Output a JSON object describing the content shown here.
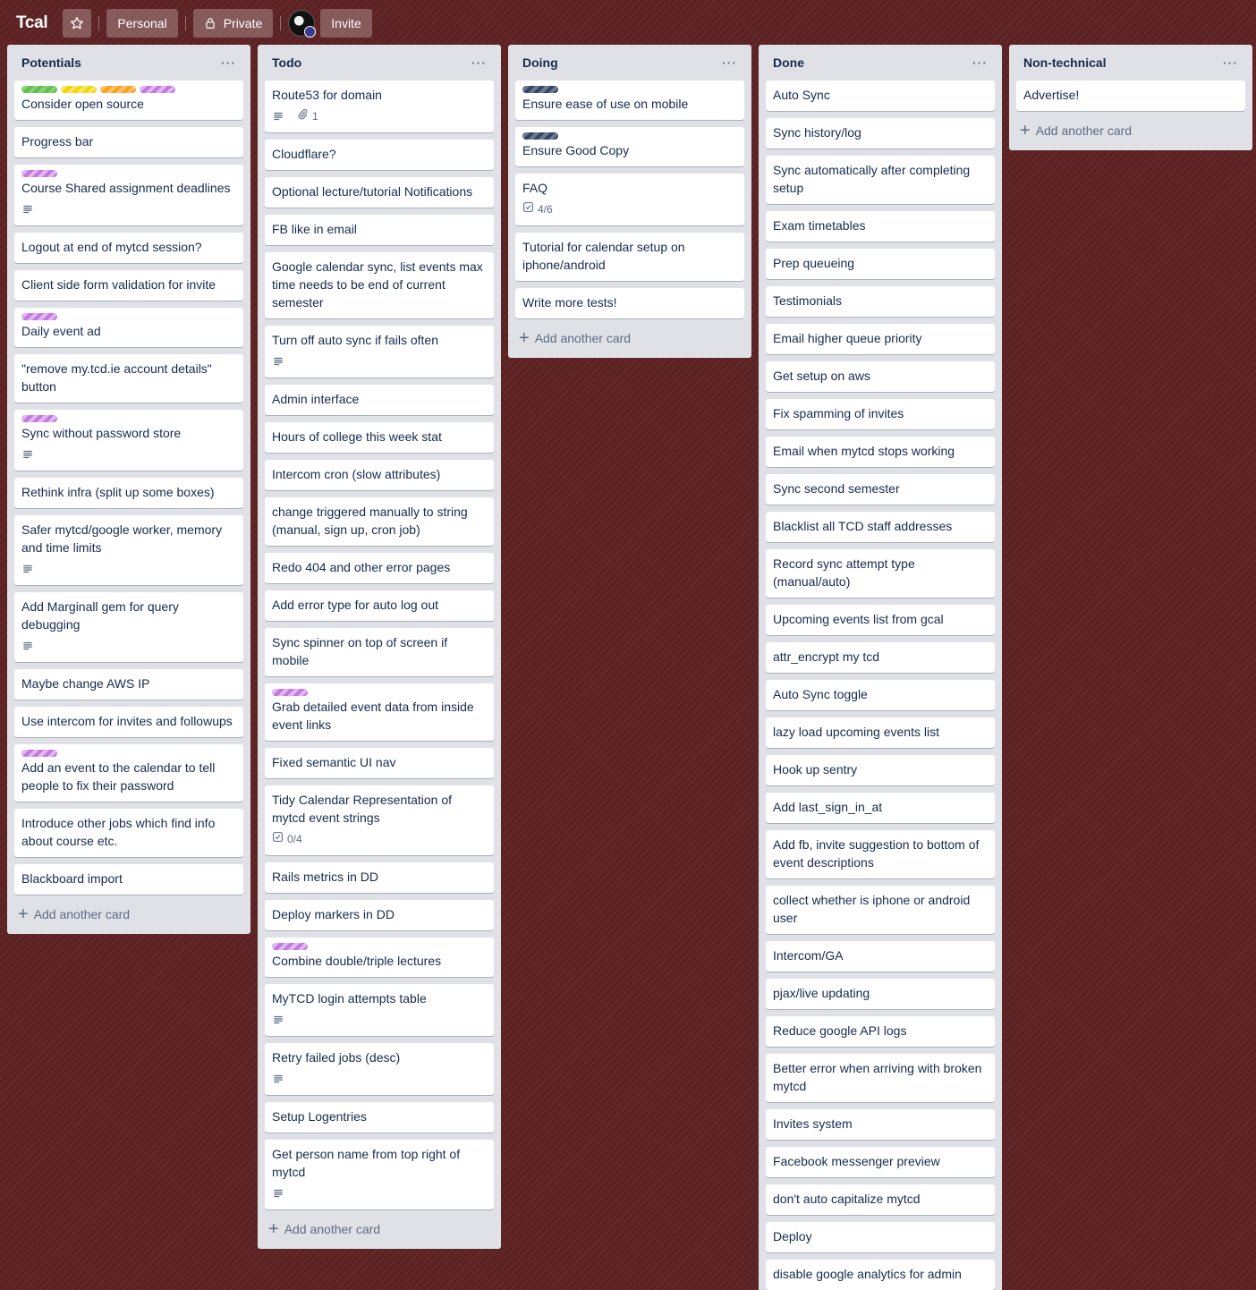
{
  "header": {
    "board_title": "Tcal",
    "team_button": "Personal",
    "visibility_button": "Private",
    "invite_button": "Invite"
  },
  "add_card_label": "Add another card",
  "label_colors": {
    "green": "#61bd4f",
    "yellow": "#f2d600",
    "orange": "#ff9f1a",
    "purple": "#c377e0",
    "navy": "#344563"
  },
  "lists": [
    {
      "title": "Potentials",
      "cards": [
        {
          "title": "Consider open source",
          "labels": [
            "green",
            "yellow",
            "orange",
            "purple"
          ]
        },
        {
          "title": "Progress bar"
        },
        {
          "title": "Course Shared assignment deadlines",
          "labels": [
            "purple"
          ],
          "description": true
        },
        {
          "title": "Logout at end of mytcd session?"
        },
        {
          "title": "Client side form validation for invite"
        },
        {
          "title": "Daily event ad",
          "labels": [
            "purple"
          ]
        },
        {
          "title": "\"remove my.tcd.ie account details\" button"
        },
        {
          "title": "Sync without password store",
          "labels": [
            "purple"
          ],
          "description": true
        },
        {
          "title": "Rethink infra (split up some boxes)"
        },
        {
          "title": "Safer mytcd/google worker, memory and time limits",
          "description": true
        },
        {
          "title": "Add Marginall gem for query debugging",
          "description": true
        },
        {
          "title": "Maybe change AWS IP"
        },
        {
          "title": "Use intercom for invites and followups"
        },
        {
          "title": "Add an event to the calendar to tell people to fix their password",
          "labels": [
            "purple"
          ]
        },
        {
          "title": "Introduce other jobs which find info about course etc."
        },
        {
          "title": "Blackboard import"
        }
      ]
    },
    {
      "title": "Todo",
      "cards": [
        {
          "title": "Route53 for domain",
          "description": true,
          "attachments": "1"
        },
        {
          "title": "Cloudflare?"
        },
        {
          "title": "Optional lecture/tutorial Notifications"
        },
        {
          "title": "FB like in email"
        },
        {
          "title": "Google calendar sync, list events max time needs to be end of current semester"
        },
        {
          "title": "Turn off auto sync if fails often",
          "description": true
        },
        {
          "title": "Admin interface"
        },
        {
          "title": "Hours of college this week stat"
        },
        {
          "title": "Intercom cron (slow attributes)"
        },
        {
          "title": "change triggered manually to string (manual, sign up, cron job)"
        },
        {
          "title": "Redo 404 and other error pages"
        },
        {
          "title": "Add error type for auto log out"
        },
        {
          "title": "Sync spinner on top of screen if mobile"
        },
        {
          "title": "Grab detailed event data from inside event links",
          "labels": [
            "purple"
          ]
        },
        {
          "title": "Fixed semantic UI nav"
        },
        {
          "title": "Tidy Calendar Representation of mytcd event strings",
          "checklist": "0/4"
        },
        {
          "title": "Rails metrics in DD"
        },
        {
          "title": "Deploy markers in DD"
        },
        {
          "title": "Combine double/triple lectures",
          "labels": [
            "purple"
          ]
        },
        {
          "title": "MyTCD login attempts table",
          "description": true
        },
        {
          "title": "Retry failed jobs (desc)",
          "description": true
        },
        {
          "title": "Setup Logentries"
        },
        {
          "title": "Get person name from top right of mytcd",
          "description": true
        }
      ]
    },
    {
      "title": "Doing",
      "cards": [
        {
          "title": "Ensure ease of use on mobile",
          "labels": [
            "navy"
          ]
        },
        {
          "title": "Ensure Good Copy",
          "labels": [
            "navy"
          ]
        },
        {
          "title": "FAQ",
          "checklist": "4/6"
        },
        {
          "title": "Tutorial for calendar setup on iphone/android"
        },
        {
          "title": "Write more tests!"
        }
      ]
    },
    {
      "title": "Done",
      "cards": [
        {
          "title": "Auto Sync"
        },
        {
          "title": "Sync history/log"
        },
        {
          "title": "Sync automatically after completing setup"
        },
        {
          "title": "Exam timetables"
        },
        {
          "title": "Prep queueing"
        },
        {
          "title": "Testimonials"
        },
        {
          "title": "Email higher queue priority"
        },
        {
          "title": "Get setup on aws"
        },
        {
          "title": "Fix spamming of invites"
        },
        {
          "title": "Email when mytcd stops working"
        },
        {
          "title": "Sync second semester"
        },
        {
          "title": "Blacklist all TCD staff addresses"
        },
        {
          "title": "Record sync attempt type (manual/auto)"
        },
        {
          "title": "Upcoming events list from gcal"
        },
        {
          "title": "attr_encrypt my tcd"
        },
        {
          "title": "Auto Sync toggle"
        },
        {
          "title": "lazy load upcoming events list"
        },
        {
          "title": "Hook up sentry"
        },
        {
          "title": "Add last_sign_in_at"
        },
        {
          "title": "Add fb, invite suggestion to bottom of event descriptions"
        },
        {
          "title": "collect whether is iphone or android user"
        },
        {
          "title": "Intercom/GA"
        },
        {
          "title": "pjax/live updating"
        },
        {
          "title": "Reduce google API logs"
        },
        {
          "title": "Better error when arriving with broken mytcd"
        },
        {
          "title": "Invites system"
        },
        {
          "title": "Facebook messenger preview"
        },
        {
          "title": "don't auto capitalize mytcd"
        },
        {
          "title": "Deploy"
        },
        {
          "title": "disable google analytics for admin"
        }
      ]
    },
    {
      "title": "Non-technical",
      "cards": [
        {
          "title": "Advertise!"
        }
      ]
    }
  ]
}
